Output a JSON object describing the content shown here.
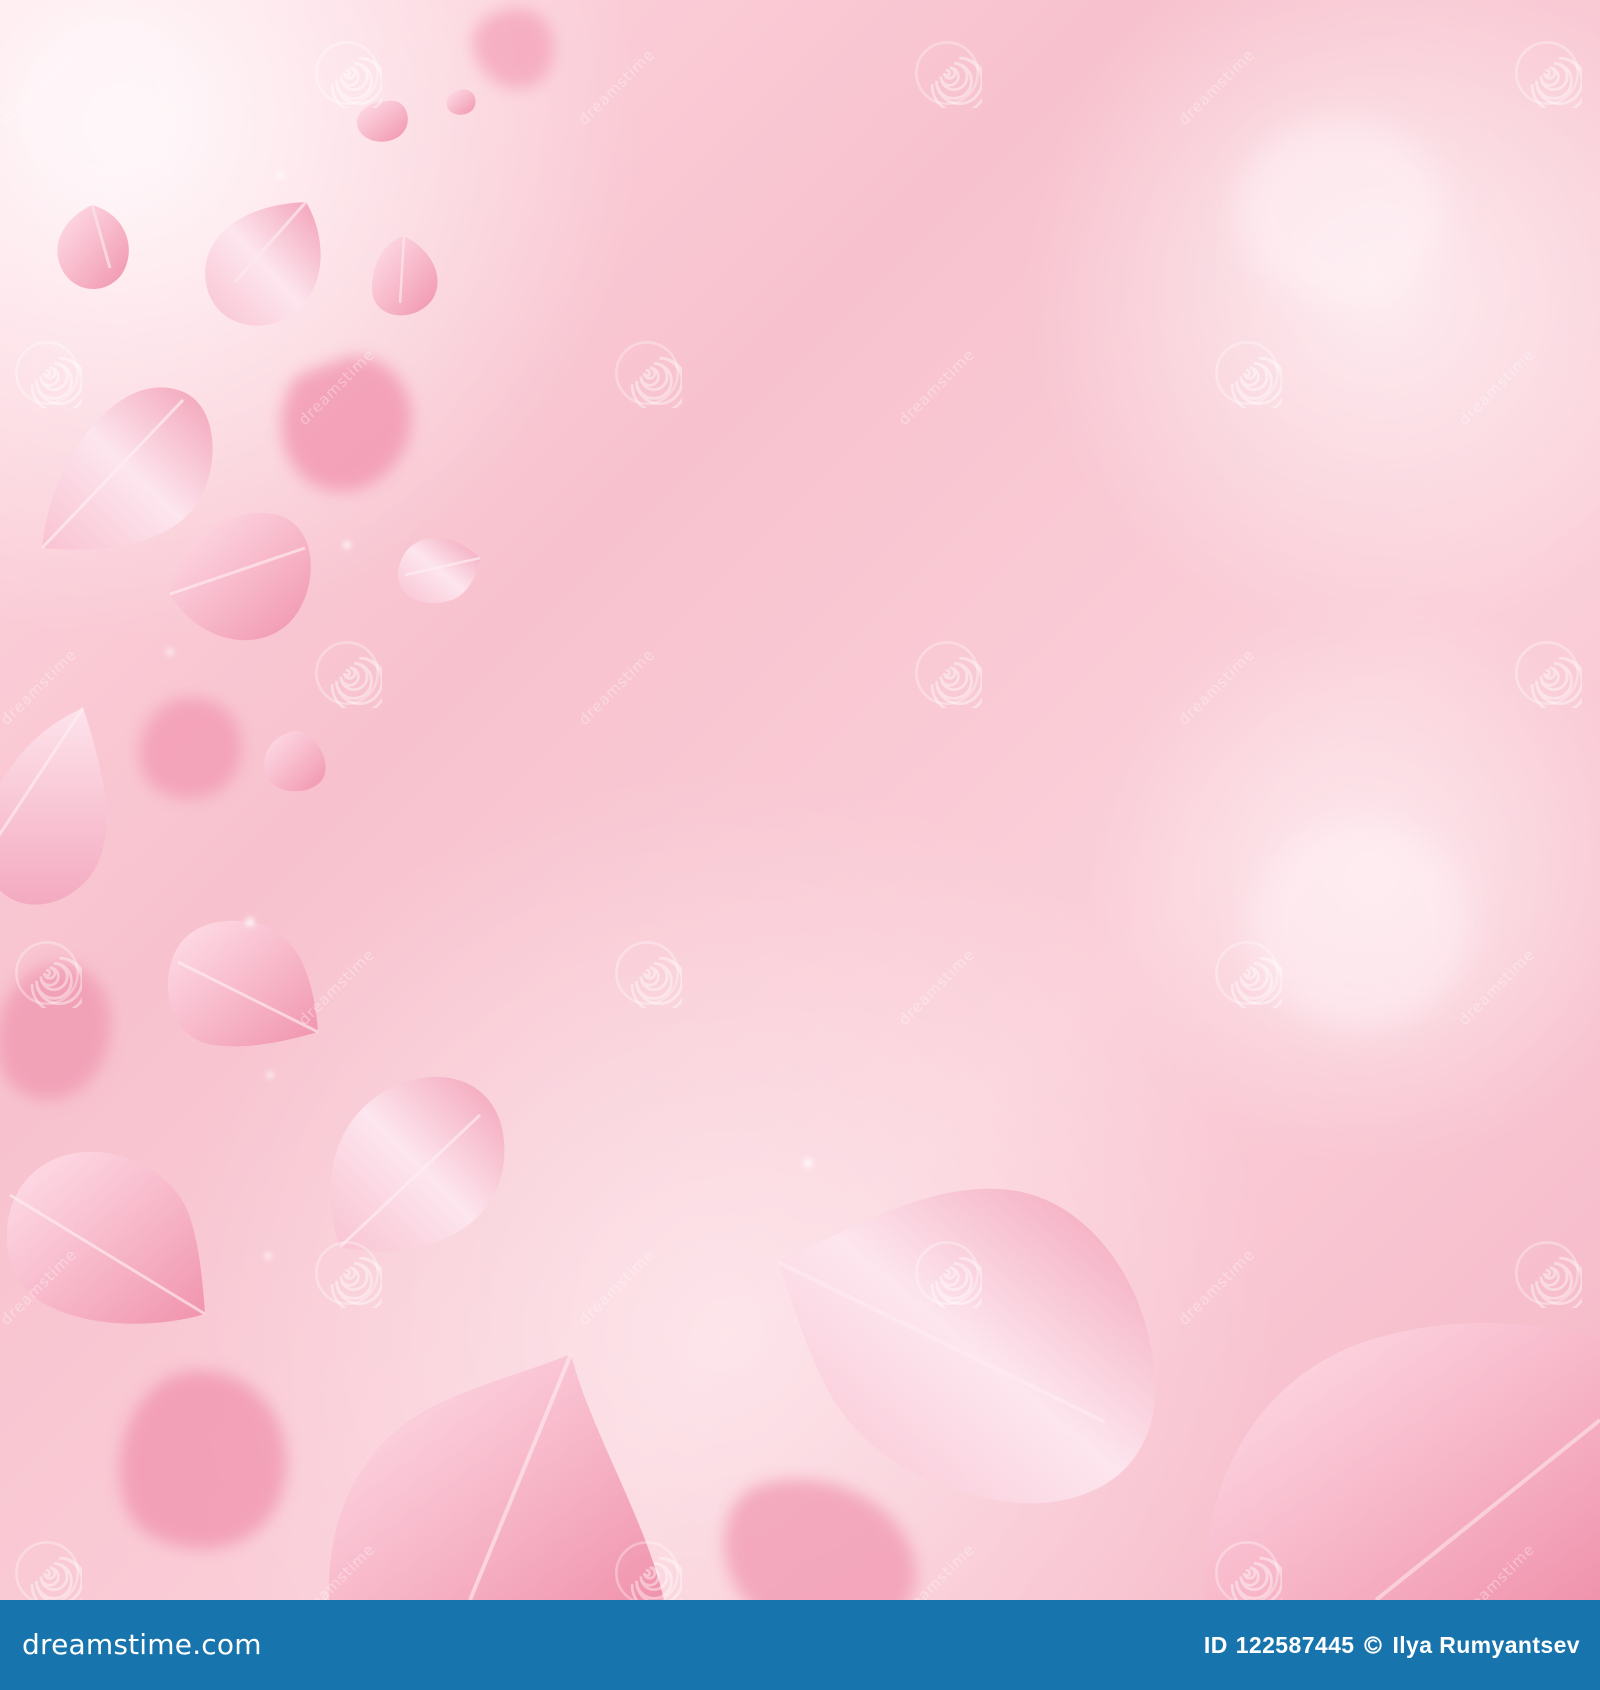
{
  "image": {
    "background_colors": {
      "base": "#f7c6cf",
      "light": "#ffe7ee",
      "rose": "#f4a8bb",
      "deep_rose": "#e98fa9",
      "white_glow": "#ffffff"
    },
    "watermark_text": "dreamstime",
    "footer": {
      "brand_prefix": "dreamstime",
      "brand_suffix": ".com",
      "id_label": "ID",
      "id_value": "122587445",
      "author": "Ilya  Rumyantsev",
      "background_color": "#1874ad",
      "text_color": "#ffffff"
    }
  }
}
